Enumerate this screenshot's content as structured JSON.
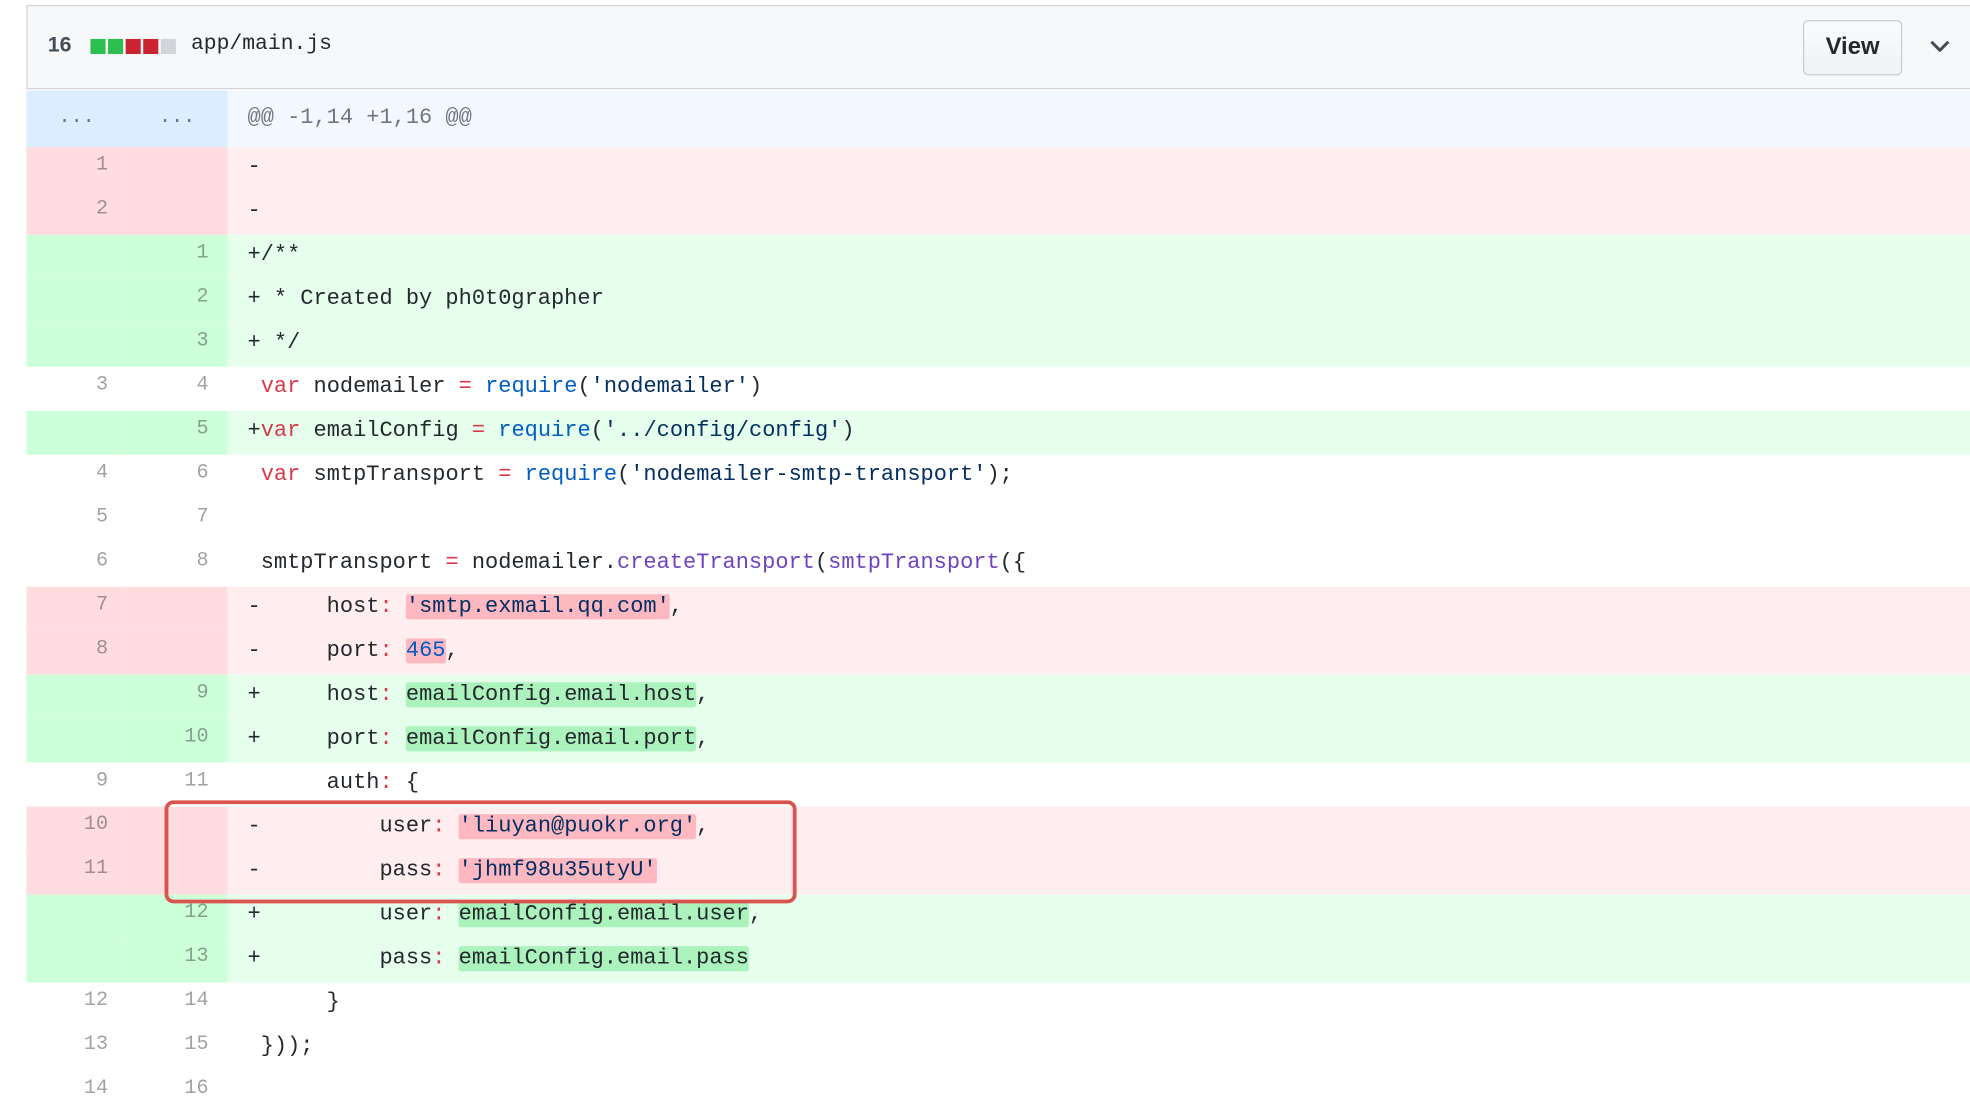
{
  "file": {
    "changes": "16",
    "stat_colors": [
      "#2cbe4e",
      "#2cbe4e",
      "#cb2431",
      "#cb2431",
      "#d1d5da"
    ],
    "name": "app/main.js",
    "view_label": "View",
    "chevron_icon": "chevron-down-icon"
  },
  "diff": {
    "hunk": {
      "old": "...",
      "new": "...",
      "text": "@@ -1,14 +1,16 @@"
    },
    "rows": [
      {
        "type": "del",
        "old": "1",
        "new": "",
        "parts": [
          {
            "t": "-"
          }
        ]
      },
      {
        "type": "del",
        "old": "2",
        "new": "",
        "parts": [
          {
            "t": "-"
          }
        ]
      },
      {
        "type": "add",
        "old": "",
        "new": "1",
        "parts": [
          {
            "t": "+/**"
          }
        ]
      },
      {
        "type": "add",
        "old": "",
        "new": "2",
        "parts": [
          {
            "t": "+ * Created by ph0t0grapher"
          }
        ]
      },
      {
        "type": "add",
        "old": "",
        "new": "3",
        "parts": [
          {
            "t": "+ */"
          }
        ]
      },
      {
        "type": "ctx",
        "old": "3",
        "new": "4",
        "parts": [
          {
            "t": " "
          },
          {
            "t": "var",
            "c": "kw"
          },
          {
            "t": " nodemailer "
          },
          {
            "t": "=",
            "c": "kw"
          },
          {
            "t": " "
          },
          {
            "t": "require",
            "c": "nm"
          },
          {
            "t": "("
          },
          {
            "t": "'nodemailer'",
            "c": "st"
          },
          {
            "t": ")"
          }
        ]
      },
      {
        "type": "add",
        "old": "",
        "new": "5",
        "parts": [
          {
            "t": "+"
          },
          {
            "t": "var",
            "c": "kw"
          },
          {
            "t": " emailConfig "
          },
          {
            "t": "=",
            "c": "kw"
          },
          {
            "t": " "
          },
          {
            "t": "require",
            "c": "nm"
          },
          {
            "t": "("
          },
          {
            "t": "'../config/config'",
            "c": "st"
          },
          {
            "t": ")"
          }
        ]
      },
      {
        "type": "ctx",
        "old": "4",
        "new": "6",
        "parts": [
          {
            "t": " "
          },
          {
            "t": "var",
            "c": "kw"
          },
          {
            "t": " smtpTransport "
          },
          {
            "t": "=",
            "c": "kw"
          },
          {
            "t": " "
          },
          {
            "t": "require",
            "c": "nm"
          },
          {
            "t": "("
          },
          {
            "t": "'nodemailer-smtp-transport'",
            "c": "st"
          },
          {
            "t": ");"
          }
        ]
      },
      {
        "type": "ctx",
        "old": "5",
        "new": "7",
        "parts": [
          {
            "t": " "
          }
        ]
      },
      {
        "type": "ctx",
        "old": "6",
        "new": "8",
        "parts": [
          {
            "t": " smtpTransport "
          },
          {
            "t": "=",
            "c": "kw"
          },
          {
            "t": " nodemailer."
          },
          {
            "t": "createTransport",
            "c": "fn"
          },
          {
            "t": "("
          },
          {
            "t": "smtpTransport",
            "c": "fn"
          },
          {
            "t": "({"
          }
        ]
      },
      {
        "type": "del",
        "old": "7",
        "new": "",
        "parts": [
          {
            "t": "-     host"
          },
          {
            "t": ":",
            "c": "kw"
          },
          {
            "t": " "
          },
          {
            "t": "'smtp.exmail.qq.com'",
            "c": "st",
            "x": "x-del"
          },
          {
            "t": ","
          }
        ]
      },
      {
        "type": "del",
        "old": "8",
        "new": "",
        "parts": [
          {
            "t": "-     port"
          },
          {
            "t": ":",
            "c": "kw"
          },
          {
            "t": " "
          },
          {
            "t": "465",
            "c": "nm",
            "x": "x-del"
          },
          {
            "t": ","
          }
        ]
      },
      {
        "type": "add",
        "old": "",
        "new": "9",
        "parts": [
          {
            "t": "+     host"
          },
          {
            "t": ":",
            "c": "kw"
          },
          {
            "t": " "
          },
          {
            "t": "emailConfig.email.host",
            "x": "x-add"
          },
          {
            "t": ","
          }
        ]
      },
      {
        "type": "add",
        "old": "",
        "new": "10",
        "parts": [
          {
            "t": "+     port"
          },
          {
            "t": ":",
            "c": "kw"
          },
          {
            "t": " "
          },
          {
            "t": "emailConfig.email.port",
            "x": "x-add"
          },
          {
            "t": ","
          }
        ]
      },
      {
        "type": "ctx",
        "old": "9",
        "new": "11",
        "parts": [
          {
            "t": "      auth"
          },
          {
            "t": ":",
            "c": "kw"
          },
          {
            "t": " {"
          }
        ]
      },
      {
        "type": "del",
        "old": "10",
        "new": "",
        "parts": [
          {
            "t": "-         user"
          },
          {
            "t": ":",
            "c": "kw"
          },
          {
            "t": " "
          },
          {
            "t": "'liuyan@puokr.org'",
            "c": "st",
            "x": "x-del"
          },
          {
            "t": ","
          }
        ]
      },
      {
        "type": "del",
        "old": "11",
        "new": "",
        "parts": [
          {
            "t": "-         pass"
          },
          {
            "t": ":",
            "c": "kw"
          },
          {
            "t": " "
          },
          {
            "t": "'jhmf98u35utyU'",
            "c": "st",
            "x": "x-del"
          }
        ]
      },
      {
        "type": "add",
        "old": "",
        "new": "12",
        "parts": [
          {
            "t": "+         user"
          },
          {
            "t": ":",
            "c": "kw"
          },
          {
            "t": " "
          },
          {
            "t": "emailConfig.email.user",
            "x": "x-add"
          },
          {
            "t": ","
          }
        ]
      },
      {
        "type": "add",
        "old": "",
        "new": "13",
        "parts": [
          {
            "t": "+         pass"
          },
          {
            "t": ":",
            "c": "kw"
          },
          {
            "t": " "
          },
          {
            "t": "emailConfig.email.pass",
            "x": "x-add"
          }
        ]
      },
      {
        "type": "ctx",
        "old": "12",
        "new": "14",
        "parts": [
          {
            "t": "      }"
          }
        ]
      },
      {
        "type": "ctx",
        "old": "13",
        "new": "15",
        "parts": [
          {
            "t": " }));"
          }
        ]
      },
      {
        "type": "ctx",
        "old": "14",
        "new": "16",
        "parts": [
          {
            "t": " "
          }
        ]
      }
    ]
  },
  "colors": {
    "highlight_box": "#d9534f"
  }
}
